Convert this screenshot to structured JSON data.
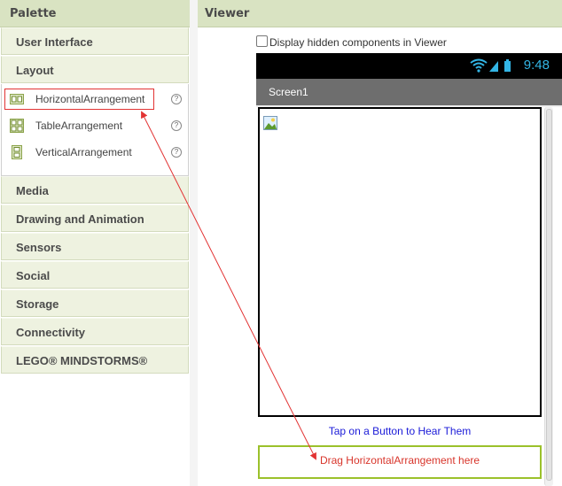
{
  "palette": {
    "title": "Palette",
    "drawers_top": [
      {
        "label": "User Interface"
      },
      {
        "label": "Layout"
      }
    ],
    "layout_items": [
      {
        "label": "HorizontalArrangement",
        "icon": "horizontal-arrangement-icon",
        "selected": true
      },
      {
        "label": "TableArrangement",
        "icon": "table-arrangement-icon"
      },
      {
        "label": "VerticalArrangement",
        "icon": "vertical-arrangement-icon"
      }
    ],
    "help_glyph": "?",
    "drawers_bottom": [
      {
        "label": "Media"
      },
      {
        "label": "Drawing and Animation"
      },
      {
        "label": "Sensors"
      },
      {
        "label": "Social"
      },
      {
        "label": "Storage"
      },
      {
        "label": "Connectivity"
      },
      {
        "label": "LEGO® MINDSTORMS®"
      }
    ]
  },
  "viewer": {
    "title": "Viewer",
    "hidden_components_label": "Display hidden components in Viewer",
    "status_time": "9:48",
    "screen_title": "Screen1",
    "tap_label": "Tap on a Button to Hear Them",
    "drop_hint": "Drag HorizontalArrangement here"
  },
  "colors": {
    "palette_header": "#d9e3c2",
    "drawer_bg": "#eef2e0",
    "status_time": "#33b5e5",
    "tap_label": "#1a1ad8",
    "drop_hint": "#d8352b",
    "drop_border": "#9bc12b",
    "highlight": "#e23333"
  }
}
